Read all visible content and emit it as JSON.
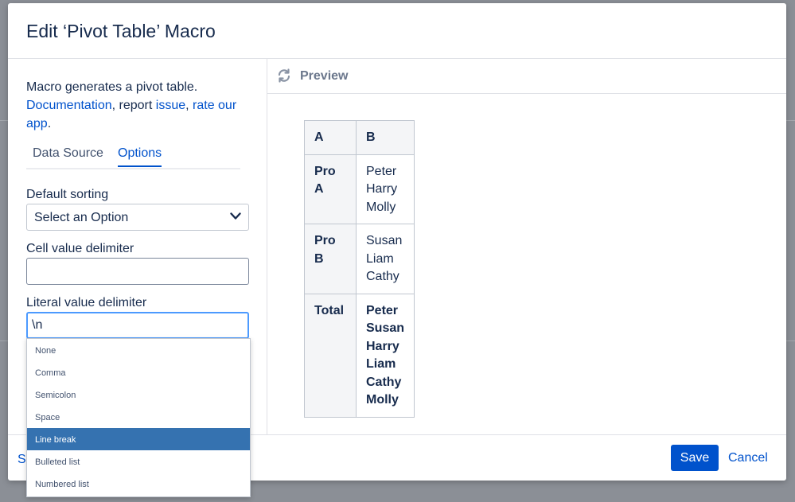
{
  "dialog": {
    "title": "Edit ‘Pivot Table’ Macro"
  },
  "intro": {
    "text": "Macro generates a pivot table.",
    "documentation_link": "Documentation",
    "separator1": ", report ",
    "issue_link": "issue",
    "separator2": ", ",
    "rate_link": "rate our app",
    "end": "."
  },
  "tabs": [
    {
      "label": "Data Source",
      "active": false
    },
    {
      "label": "Options",
      "active": true
    }
  ],
  "fields": {
    "default_sorting": {
      "label": "Default sorting",
      "value": "Select an Option"
    },
    "cell_value_delimiter": {
      "label": "Cell value delimiter",
      "value": ""
    },
    "literal_value_delimiter": {
      "label": "Literal value delimiter",
      "value": "\\n"
    }
  },
  "dropdown": {
    "options": [
      "None",
      "Comma",
      "Semicolon",
      "Space",
      "Line break",
      "Bulleted list",
      "Numbered list"
    ],
    "selected": "Line break"
  },
  "footer": {
    "left_link_partial": "S",
    "save_label": "Save",
    "cancel_label": "Cancel"
  },
  "preview": {
    "title": "Preview",
    "icon": "refresh-icon",
    "table": {
      "headers": [
        "A",
        "B"
      ],
      "rows": [
        {
          "label": "Pro A",
          "values": [
            "Peter",
            "Harry",
            "Molly"
          ],
          "bold": false
        },
        {
          "label": "Pro B",
          "values": [
            "Susan",
            "Liam",
            "Cathy"
          ],
          "bold": false
        },
        {
          "label": "Total",
          "values": [
            "Peter",
            "Susan",
            "Harry",
            "Liam",
            "Cathy",
            "Molly"
          ],
          "bold": true
        }
      ]
    }
  },
  "colors": {
    "primary": "#0052cc",
    "selected_option": "#3572b0",
    "focus_border": "#4c9aff",
    "text": "#172b4d"
  }
}
